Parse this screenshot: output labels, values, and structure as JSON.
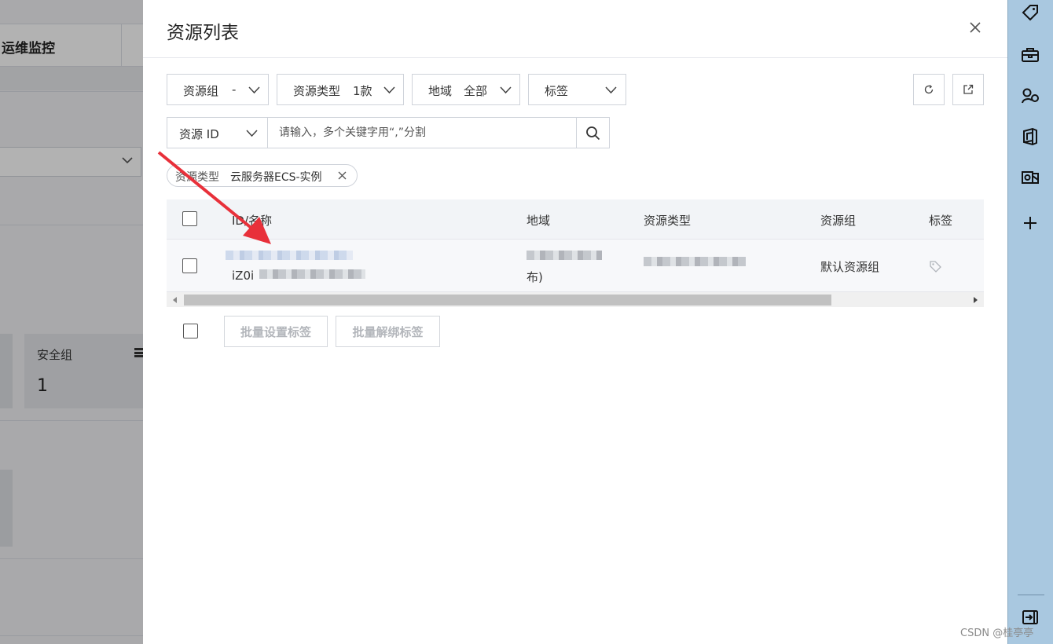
{
  "background": {
    "tab_label": "运维监控",
    "card_label": "安全组",
    "card_value": "1"
  },
  "drawer": {
    "title": "资源列表",
    "filters": {
      "resource_group": {
        "label": "资源组",
        "value": "-"
      },
      "resource_type": {
        "label": "资源类型",
        "value": "1款"
      },
      "region": {
        "label": "地域",
        "value": "全部"
      },
      "tag": {
        "label": "标签"
      }
    },
    "search": {
      "field_label": "资源 ID",
      "placeholder": "请输入，多个关键字用“,”分割"
    },
    "active_filter": {
      "key": "资源类型",
      "value": "云服务器ECS-实例"
    },
    "table": {
      "columns": [
        "ID/名称",
        "地域",
        "资源类型",
        "资源组",
        "标签"
      ],
      "rows": [
        {
          "name_visible": "iZ0i",
          "region_visible": "布)",
          "resource_group": "默认资源组"
        }
      ]
    },
    "batch": {
      "set_tags": "批量设置标签",
      "unbind_tags": "批量解绑标签"
    }
  },
  "watermark": "CSDN @桂亭亭",
  "colors": {
    "accent": "#0064c8",
    "annotation_arrow": "#e8303a",
    "sidebar": "#a9c8e0"
  }
}
